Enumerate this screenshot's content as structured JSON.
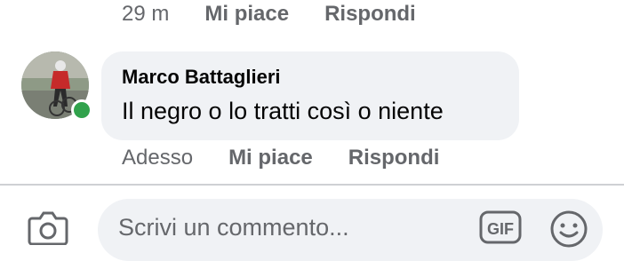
{
  "previous_comment": {
    "time": "29 m",
    "like_label": "Mi piace",
    "reply_label": "Rispondi"
  },
  "comment": {
    "author": "Marco Battaglieri",
    "text": "Il negro o lo tratti così o niente",
    "time": "Adesso",
    "like_label": "Mi piace",
    "reply_label": "Rispondi",
    "online": true
  },
  "composer": {
    "placeholder": "Scrivi un commento...",
    "camera_icon": "camera-icon",
    "gif_icon": "gif-icon",
    "emoji_icon": "emoji-icon"
  },
  "colors": {
    "bubble": "#f0f2f5",
    "secondary_text": "#65676b",
    "online": "#31a24c"
  }
}
